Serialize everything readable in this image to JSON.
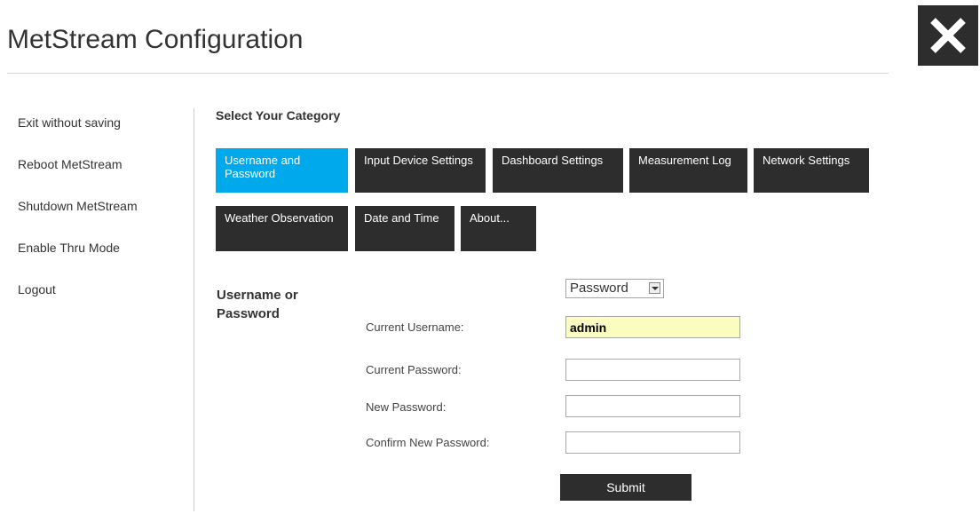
{
  "header": {
    "title": "MetStream Configuration",
    "close_icon": "close-icon"
  },
  "sidebar": {
    "items": [
      {
        "label": "Exit without saving"
      },
      {
        "label": "Reboot MetStream"
      },
      {
        "label": "Shutdown MetStream"
      },
      {
        "label": "Enable Thru Mode"
      },
      {
        "label": "Logout"
      }
    ]
  },
  "main": {
    "heading": "Select Your Category",
    "tabs": [
      {
        "label": "Username and Password",
        "active": true
      },
      {
        "label": "Input Device Settings",
        "active": false
      },
      {
        "label": "Dashboard Settings",
        "active": false
      },
      {
        "label": "Measurement Log",
        "active": false
      },
      {
        "label": "Network Settings",
        "active": false
      },
      {
        "label": "Weather Observation",
        "active": false
      },
      {
        "label": "Date and Time",
        "active": false
      },
      {
        "label": "About...",
        "active": false
      }
    ],
    "colors": {
      "active_tab": "#00a8ec",
      "tab": "#2d2d2d",
      "filled_input": "#fbfcbf"
    }
  },
  "form": {
    "section_label": "Username or Password",
    "mode_select": {
      "selected": "Password"
    },
    "fields": {
      "current_username": {
        "label": "Current Username:",
        "value": "admin"
      },
      "current_password": {
        "label": "Current Password:",
        "value": ""
      },
      "new_password": {
        "label": "New Password:",
        "value": ""
      },
      "confirm_password": {
        "label": "Confirm New Password:",
        "value": ""
      }
    },
    "submit_label": "Submit"
  }
}
